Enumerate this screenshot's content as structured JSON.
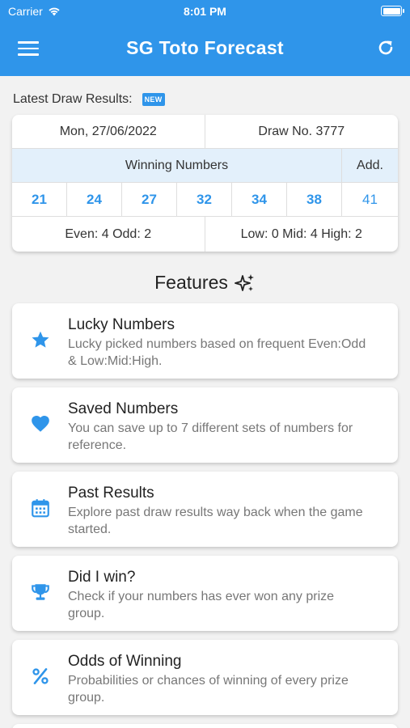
{
  "status_bar": {
    "carrier": "Carrier",
    "time": "8:01 PM"
  },
  "app_bar": {
    "title": "SG Toto Forecast"
  },
  "latest": {
    "label": "Latest Draw Results:",
    "badge": "NEW",
    "date": "Mon, 27/06/2022",
    "draw_no": "Draw No. 3777",
    "winning_label": "Winning Numbers",
    "add_label": "Add.",
    "numbers": [
      "21",
      "24",
      "27",
      "32",
      "34",
      "38"
    ],
    "additional": "41",
    "even_odd": "Even: 4 Odd: 2",
    "low_mid_high": "Low: 0 Mid: 4 High: 2"
  },
  "features": {
    "title": "Features",
    "items": [
      {
        "title": "Lucky Numbers",
        "desc": "Lucky picked numbers based on frequent Even:Odd & Low:Mid:High.",
        "icon": "star-icon"
      },
      {
        "title": "Saved Numbers",
        "desc": "You can save up to 7 different sets of numbers for reference.",
        "icon": "heart-icon"
      },
      {
        "title": "Past Results",
        "desc": "Explore past draw results way back when the game started.",
        "icon": "calendar-icon"
      },
      {
        "title": "Did I win?",
        "desc": "Check if your numbers has ever won any prize group.",
        "icon": "trophy-icon"
      },
      {
        "title": "Odds of Winning",
        "desc": "Probabilities or chances of winning of every prize group.",
        "icon": "percent-icon"
      }
    ]
  },
  "colors": {
    "primary": "#2f95ea",
    "background": "#f2f2f2",
    "highlight_row": "#e3f0fb"
  }
}
